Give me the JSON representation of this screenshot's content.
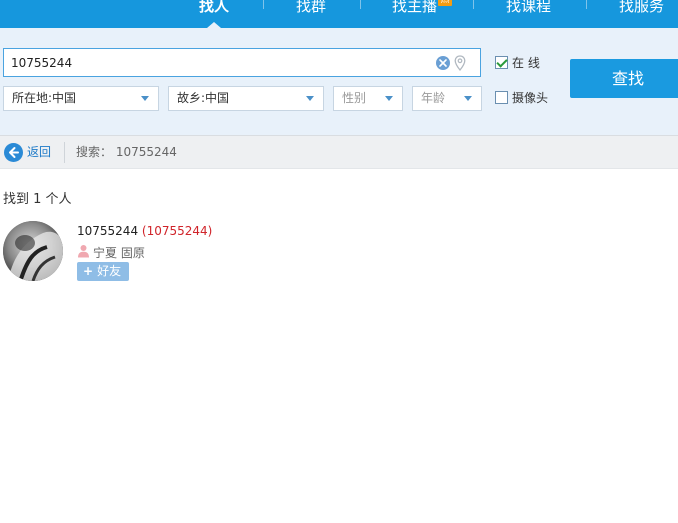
{
  "nav": {
    "tabs": [
      {
        "label": "找人",
        "active": true
      },
      {
        "label": "找群"
      },
      {
        "label": "找主播",
        "badge": "热"
      },
      {
        "label": "找课程"
      },
      {
        "label": "找服务"
      }
    ]
  },
  "search": {
    "query": "10755244",
    "online_label": "在 线",
    "online_checked": true,
    "camera_label": "摄像头",
    "camera_checked": false,
    "button_label": "查找",
    "filters": {
      "location": "所在地:中国",
      "hometown": "故乡:中国",
      "gender": "性别",
      "age": "年龄"
    }
  },
  "breadcrumb": {
    "back_label": "返回",
    "search_prefix": "搜索：",
    "search_term": "10755244"
  },
  "results": {
    "count_text": "找到 1 个人",
    "items": [
      {
        "nickname": "10755244",
        "number": "(10755244)",
        "location": "宁夏 固原",
        "add_label": "好友"
      }
    ]
  },
  "colors": {
    "nav_bg": "#1697dd",
    "panel_bg": "#e8f1fa",
    "accent": "#1a9ae0",
    "id_red": "#d0242a"
  }
}
